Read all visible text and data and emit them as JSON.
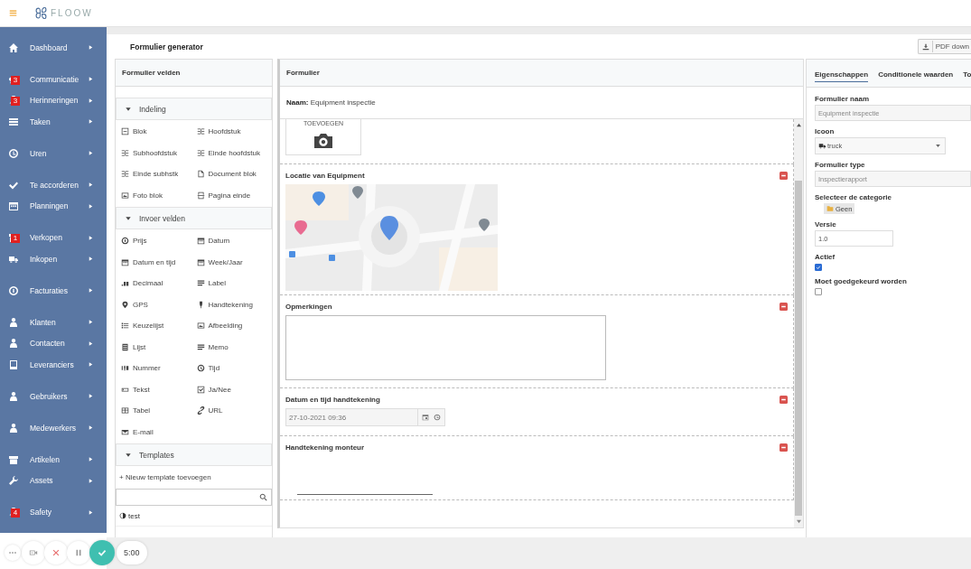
{
  "topbar": {
    "logo_text": "FLOOW"
  },
  "sidebar": {
    "groups": [
      {
        "items": [
          {
            "label": "Dashboard"
          }
        ]
      },
      {
        "items": [
          {
            "label": "Communicatie",
            "badge": "3"
          },
          {
            "label": "Herinneringen",
            "badge": "3"
          },
          {
            "label": "Taken"
          }
        ]
      },
      {
        "items": [
          {
            "label": "Uren"
          }
        ]
      },
      {
        "items": [
          {
            "label": "Te accorderen"
          },
          {
            "label": "Planningen"
          }
        ]
      },
      {
        "items": [
          {
            "label": "Verkopen",
            "badge": "1"
          },
          {
            "label": "Inkopen"
          }
        ]
      },
      {
        "items": [
          {
            "label": "Facturaties"
          }
        ]
      },
      {
        "items": [
          {
            "label": "Klanten"
          },
          {
            "label": "Contacten"
          },
          {
            "label": "Leveranciers"
          }
        ]
      },
      {
        "items": [
          {
            "label": "Gebruikers"
          }
        ]
      },
      {
        "items": [
          {
            "label": "Medewerkers"
          }
        ]
      },
      {
        "items": [
          {
            "label": "Artikelen"
          },
          {
            "label": "Assets"
          }
        ]
      },
      {
        "items": [
          {
            "label": "Safety",
            "badge": "4"
          }
        ]
      }
    ]
  },
  "header": {
    "title": "Formulier generator",
    "pdf_button": "PDF down"
  },
  "fields_panel": {
    "title": "Formulier velden",
    "sections": [
      {
        "title": "Indeling",
        "expanded": true,
        "items": [
          "Blok",
          "Hoofdstuk",
          "Subhoofdstuk",
          "Einde hoofdstuk",
          "Einde subhstk",
          "Document blok",
          "Foto blok",
          "Pagina einde"
        ]
      },
      {
        "title": "Invoer velden",
        "expanded": true,
        "items": [
          "Prijs",
          "Datum",
          "Datum en tijd",
          "Week/Jaar",
          "Decimaal",
          "Label",
          "GPS",
          "Handtekening",
          "Keuzelijst",
          "Afbeelding",
          "Lijst",
          "Memo",
          "Nummer",
          "Tijd",
          "Tekst",
          "Ja/Nee",
          "Tabel",
          "URL",
          "E-mail"
        ]
      },
      {
        "title": "Templates",
        "expanded": true,
        "add_link": "+ Nieuw template toevoegen",
        "templates": [
          "test"
        ]
      }
    ]
  },
  "form_panel": {
    "title": "Formulier",
    "name_line": "**Naam:** Equipment inspectie",
    "blocks": [
      {
        "text": "TOEVOEGEN"
      },
      {
        "kind": "map",
        "label": "Locatie van Equipment"
      },
      {
        "kind": "textarea",
        "label": "Opmerkingen"
      },
      {
        "kind": "datetime",
        "label": "Datum en tijd handtekening",
        "value": "27-10-2021 09:36"
      },
      {
        "kind": "signature",
        "label": "Handtekening monteur"
      }
    ]
  },
  "properties_panel": {
    "tabs": [
      {
        "label": "Eigenschappen",
        "selected": true
      },
      {
        "label": "Conditionele waarden",
        "selected": false
      },
      {
        "label": "To",
        "selected": false
      }
    ],
    "fields": [
      {
        "kind": "text",
        "label": "Formulier naam",
        "value": "Equipment inspectie",
        "disabled": true
      },
      {
        "kind": "select",
        "label": "Icoon",
        "value": "truck"
      },
      {
        "kind": "text",
        "label": "Formulier type",
        "value": "Inspectierapport",
        "disabled": true
      },
      {
        "kind": "category",
        "label": "Selecteer de categorie",
        "value": "Geen"
      },
      {
        "kind": "number",
        "label": "Versie",
        "value": "1.0",
        "disabled": false
      },
      {
        "kind": "checkbox",
        "label": "Actief",
        "checked": true
      },
      {
        "kind": "checkbox",
        "label": "Moet goedgekeurd worden",
        "checked": false
      }
    ]
  },
  "recorder": {
    "timer": "5:00"
  }
}
